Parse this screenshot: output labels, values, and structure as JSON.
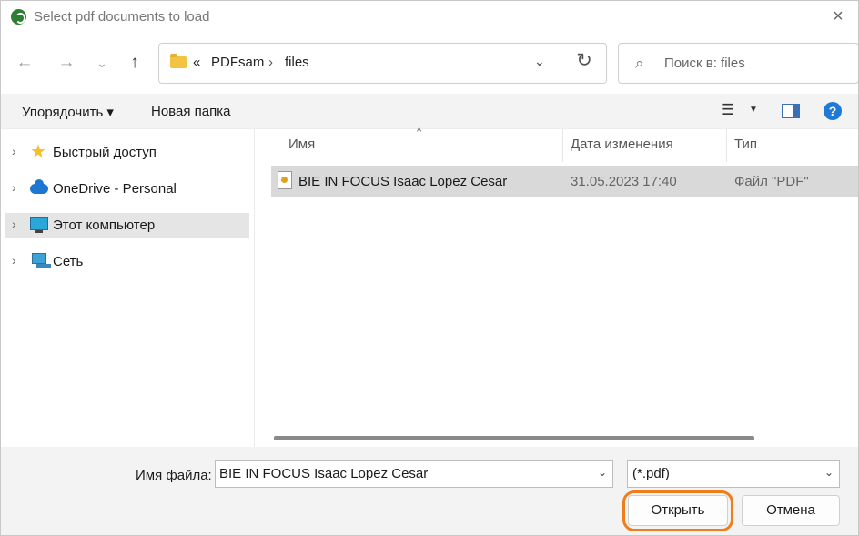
{
  "window": {
    "title": "Select pdf documents to load",
    "close_icon": "×"
  },
  "nav": {
    "back_icon": "←",
    "forward_icon": "→",
    "recent_icon": "⌄",
    "up_icon": "↑",
    "address": {
      "overflow": "«",
      "crumbs": [
        "PDFsam",
        "files"
      ],
      "separator": "›",
      "dropdown_icon": "⌄",
      "refresh_icon": "↻"
    },
    "search": {
      "placeholder": "Поиск в: files",
      "icon": "⌕"
    }
  },
  "toolbar": {
    "organize": "Упорядочить ▾",
    "new_folder": "Новая папка",
    "view_icon": "☰",
    "view_dropdown": "▼",
    "help": "?"
  },
  "tree": [
    {
      "label": "Быстрый доступ",
      "icon": "star-icon",
      "selected": false
    },
    {
      "label": "OneDrive - Personal",
      "icon": "cloud-icon",
      "selected": false
    },
    {
      "label": "Этот компьютер",
      "icon": "monitor-icon",
      "selected": true
    },
    {
      "label": "Сеть",
      "icon": "network-icon",
      "selected": false
    }
  ],
  "tree_chevron": "›",
  "files": {
    "columns": [
      "Имя",
      "Дата изменения",
      "Тип"
    ],
    "sort_indicator": "^",
    "rows": [
      {
        "name": "BIE IN FOCUS Isaac Lopez Cesar",
        "modified": "31.05.2023 17:40",
        "type": "Файл \"PDF\""
      }
    ]
  },
  "footer": {
    "filename_label": "Имя файла:",
    "filename_value": "BIE IN FOCUS Isaac Lopez Cesar",
    "filter_value": "(*.pdf)",
    "dropdown_icon": "⌄",
    "open_label": "Открыть",
    "cancel_label": "Отмена",
    "highlight_color": "#f07d1c"
  }
}
